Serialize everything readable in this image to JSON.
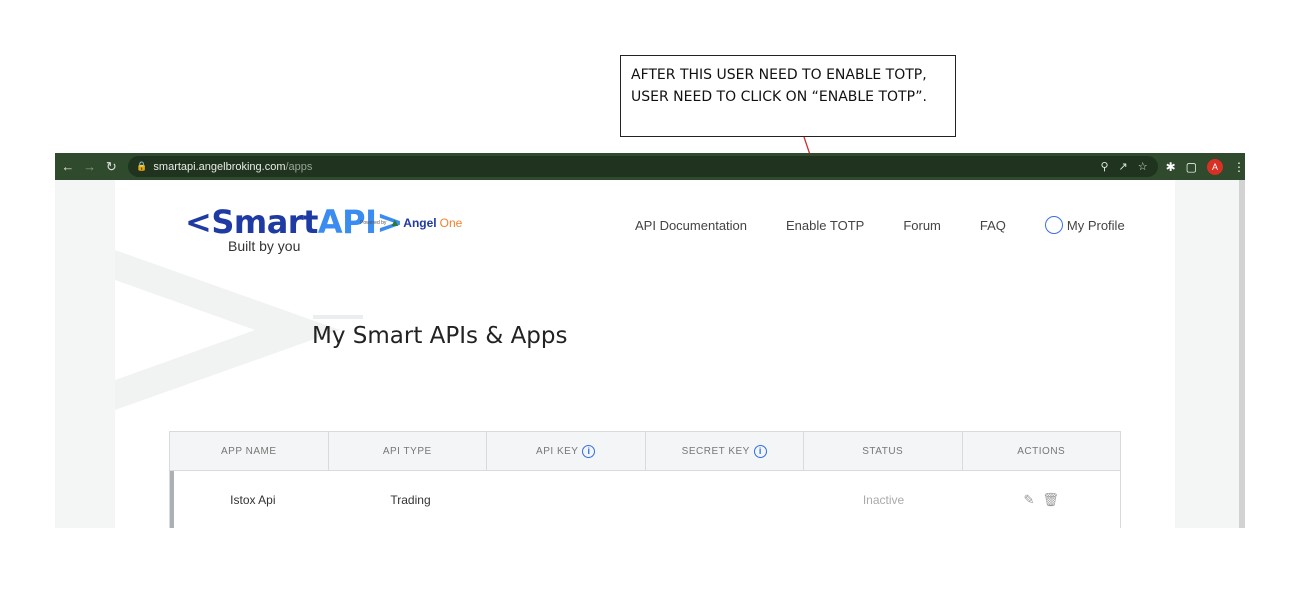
{
  "annotation": {
    "text": "AFTER THIS USER NEED TO ENABLE TOTP, USER NEED TO CLICK ON “ENABLE TOTP”."
  },
  "browser": {
    "url_domain": "smartapi.angelbroking.com",
    "url_path": "/apps",
    "profile_initial": "A"
  },
  "logo": {
    "lt": "<",
    "smart": "Smart",
    "api": "API",
    "gt": ">",
    "tagline": "Built by you",
    "powered_by": "Powered by",
    "angel": "Angel",
    "one": "One"
  },
  "nav": {
    "items": [
      {
        "label": "API Documentation"
      },
      {
        "label": "Enable TOTP"
      },
      {
        "label": "Forum"
      },
      {
        "label": "FAQ"
      }
    ],
    "profile_label": "My Profile"
  },
  "page": {
    "title": "My Smart APIs & Apps"
  },
  "table": {
    "headers": [
      "APP NAME",
      "API TYPE",
      "API KEY",
      "SECRET KEY",
      "STATUS",
      "ACTIONS"
    ],
    "rows": [
      {
        "app_name": "Istox Api",
        "api_type": "Trading",
        "api_key": "",
        "secret_key": "",
        "status": "Inactive"
      }
    ]
  },
  "colors": {
    "chrome": "#2f4a2d",
    "brand_dark": "#1e3aa3",
    "brand_light": "#3b8cf0",
    "accent": "#2c6fe6"
  }
}
